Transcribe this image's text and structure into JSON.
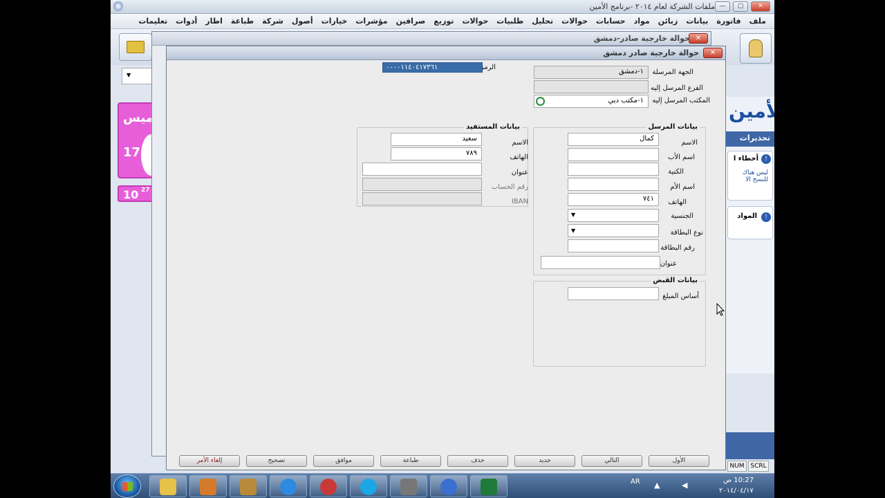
{
  "app": {
    "title": "ملفات الشركة لعام ٢٠١٤ -برنامج الأمين",
    "menu": [
      "ملف",
      "فاتورة",
      "بيانات",
      "زبائن",
      "مواد",
      "حسابات",
      "حوالات",
      "تحليل",
      "طلبيات",
      "حوالات",
      "توزيع",
      "صرافين",
      "مؤشرات",
      "خيارات",
      "أصول",
      "شركة",
      "طباعة",
      "اطار",
      "أدوات",
      "تعليمات"
    ],
    "right_panel": {
      "brand": "الأمين",
      "warnings_header": "تحذيرات",
      "item1_title": "أخطاء ا",
      "item1_text": "ليس هناك\nللنسخ الا",
      "item2_title": "المواد"
    },
    "pink_tiles": [
      {
        "text": "ميس"
      },
      {
        "text": "17"
      },
      {
        "text": "10",
        "sup": "27"
      }
    ]
  },
  "back_window": {
    "title": "حوالة خارجية صادر-دمشق"
  },
  "dialog": {
    "title": "حوالة خارجية صادر دمشق",
    "code_label": "الرمز",
    "code_value": "٠٠٠٠١١٤٠٤١٧٣٦١",
    "sender_entity_label": "الجهة المرسلة",
    "sender_entity_value": "١-دمشق",
    "target_branch_label": "الفرع المرسل إليه",
    "target_branch_value": "",
    "target_office_label": "المكتب المرسل إليه",
    "target_office_value": "١-مكتب دبي",
    "sender_group": {
      "title": "بيانات المرسل",
      "name_label": "الاسم",
      "name_value": "كمال",
      "father_label": "اسم الأب",
      "father_value": "",
      "surname_label": "الكنية",
      "surname_value": "",
      "mother_label": "اسم الأم",
      "mother_value": "",
      "phone_label": "الهاتف",
      "phone_value": "٧٤١",
      "nationality_label": "الجنسية",
      "nationality_value": "",
      "card_type_label": "نوع البطاقة",
      "card_type_value": "",
      "card_no_label": "رقم البطاقة",
      "card_no_value": "",
      "address_label": "عنوان",
      "address_value": ""
    },
    "beneficiary_group": {
      "title": "بيانات المستفيد",
      "name_label": "الاسم",
      "name_value": "سعيد",
      "phone_label": "الهاتف",
      "phone_value": "٧٨٩",
      "address_label": "عنوان",
      "address_value": "",
      "account_label": "رقم الحساب",
      "account_value": "",
      "iban_label": "IBAN",
      "iban_value": ""
    },
    "receipt_group": {
      "title": "بيانات القبض",
      "amount_label": "أساس المبلغ",
      "amount_value": ""
    },
    "footer_buttons": [
      "إلغاء الأمر",
      "تصحيح",
      "موافق",
      "طباعة",
      "حذف",
      "جديد",
      "التالي",
      "الأول"
    ]
  },
  "statusbar": {
    "num": "NUM",
    "scrl": "SCRL"
  },
  "taskbar": {
    "clock_time": "10:27 ص",
    "clock_date": "٢٠١٤/٠٤/١٧",
    "lang": "AR",
    "items": [
      "folder",
      "media",
      "tools",
      "ie",
      "tamin",
      "skype",
      "printer",
      "amin",
      "excel"
    ]
  }
}
